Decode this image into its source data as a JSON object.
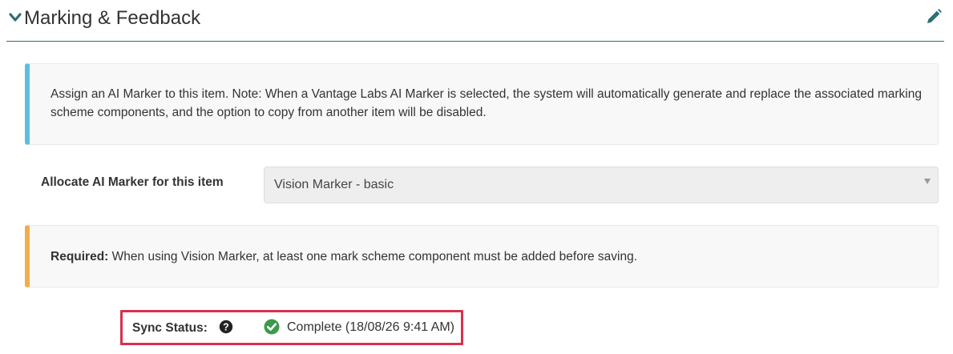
{
  "section": {
    "title": "Marking & Feedback",
    "collapse_icon": "chevron-down-icon",
    "edit_icon": "pencil-icon",
    "accent_color": "#2f6f73"
  },
  "info_alert": {
    "text": "Assign an AI Marker to this item. Note: When a Vantage Labs AI Marker is selected, the system will automatically generate and replace the associated marking scheme components, and the option to copy from another item will be disabled.",
    "border_color": "#5bc0de"
  },
  "ai_marker": {
    "label": "Allocate AI Marker for this item",
    "selected": "Vision Marker - basic"
  },
  "required_alert": {
    "prefix": "Required:",
    "text": " When using Vision Marker, at least one mark scheme component must be added before saving.",
    "border_color": "#f0ad4e"
  },
  "sync_status": {
    "label": "Sync Status:",
    "help_icon": "question-circle-icon",
    "status_icon": "check-circle-icon",
    "value": "Complete (18/08/26 9:41 AM)",
    "highlight_color": "#d9304f",
    "status_color": "#3c9a4a"
  }
}
